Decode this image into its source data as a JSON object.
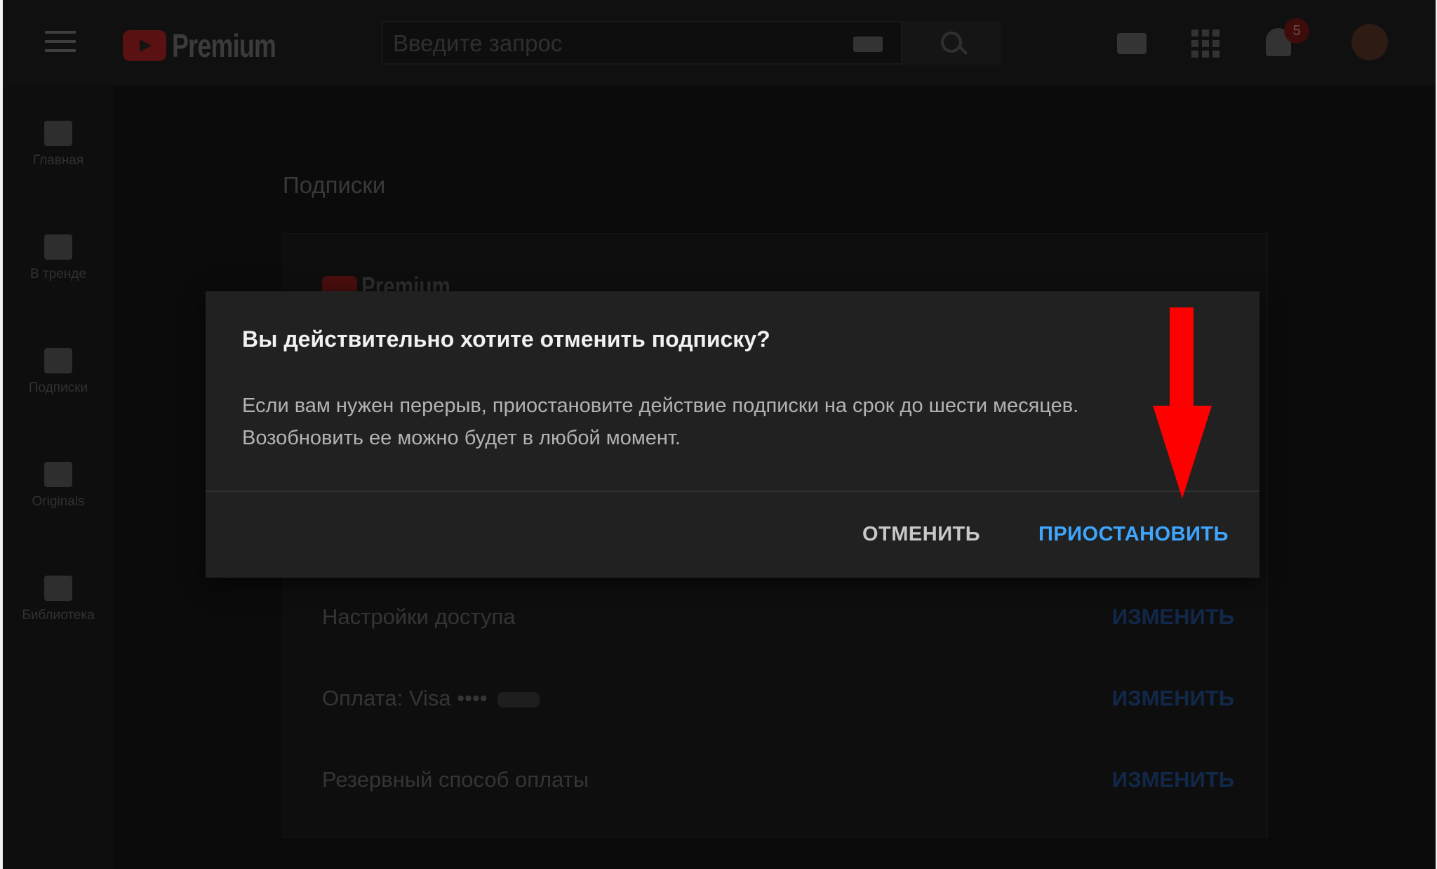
{
  "masthead": {
    "logo_text": "Premium",
    "search_placeholder": "Введите запрос",
    "notification_count": "5"
  },
  "guide": {
    "items": [
      {
        "label": "Главная",
        "icon": "home-icon"
      },
      {
        "label": "В тренде",
        "icon": "fire-icon"
      },
      {
        "label": "Подписки",
        "icon": "subscriptions-icon"
      },
      {
        "label": "Originals",
        "icon": "originals-icon"
      },
      {
        "label": "Библиотека",
        "icon": "library-icon"
      }
    ]
  },
  "page": {
    "heading": "Подписки",
    "card_logo_text": "Premium",
    "rows": [
      {
        "label": "Настройки доступа",
        "action": "ИЗМЕНИТЬ"
      },
      {
        "label": "Оплата: Visa ••••",
        "action": "ИЗМЕНИТЬ"
      },
      {
        "label": "Резервный способ оплаты",
        "action": "ИЗМЕНИТЬ"
      }
    ]
  },
  "dialog": {
    "title": "Вы действительно хотите отменить подписку?",
    "text_line1": "Если вам нужен перерыв, приостановите действие подписки на срок до шести месяцев.",
    "text_line2": "Возобновить ее можно будет в любой момент.",
    "cancel_label": "ОТМЕНИТЬ",
    "pause_label": "ПРИОСТАНОВИТЬ"
  },
  "colors": {
    "accent": "#3ea6ff",
    "annotation_arrow": "#ff0000",
    "dialog_bg": "#212121"
  }
}
